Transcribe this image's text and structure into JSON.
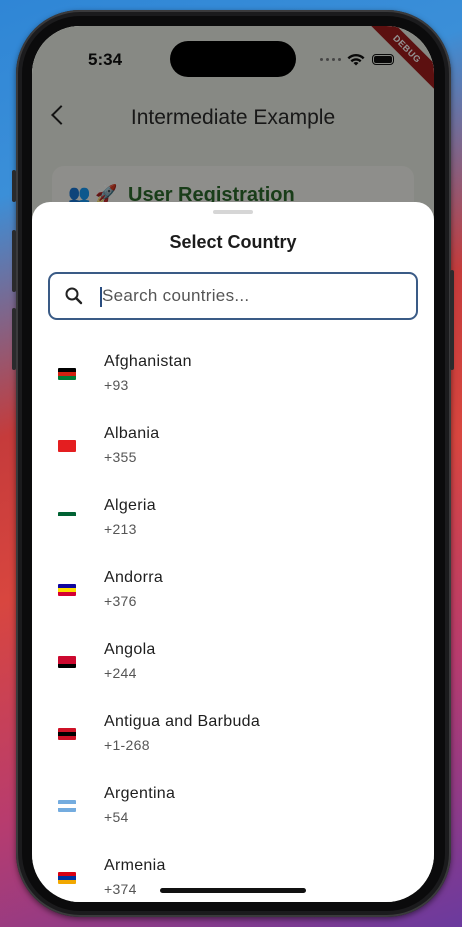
{
  "status_bar": {
    "time": "5:34",
    "debug_label": "DEBUG"
  },
  "app_bar": {
    "title": "Intermediate Example"
  },
  "background_card": {
    "title": "User Registration",
    "icons": "👥 🚀"
  },
  "sheet": {
    "title": "Select Country",
    "search": {
      "placeholder": "Search countries...",
      "value": ""
    },
    "countries": [
      {
        "name": "Afghanistan",
        "code": "+93",
        "flag_colors": [
          "#000000",
          "#d32011",
          "#007a36"
        ]
      },
      {
        "name": "Albania",
        "code": "+355",
        "flag_colors": [
          "#e41e20",
          "#e41e20",
          "#e41e20"
        ]
      },
      {
        "name": "Algeria",
        "code": "+213",
        "flag_colors": [
          "#006233",
          "#ffffff",
          "#ffffff"
        ]
      },
      {
        "name": "Andorra",
        "code": "+376",
        "flag_colors": [
          "#10069f",
          "#fedd00",
          "#d50032"
        ]
      },
      {
        "name": "Angola",
        "code": "+244",
        "flag_colors": [
          "#cc092f",
          "#cc092f",
          "#000000"
        ]
      },
      {
        "name": "Antigua and Barbuda",
        "code": "+1-268",
        "flag_colors": [
          "#ce1126",
          "#000000",
          "#ce1126"
        ]
      },
      {
        "name": "Argentina",
        "code": "+54",
        "flag_colors": [
          "#74acdf",
          "#ffffff",
          "#74acdf"
        ]
      },
      {
        "name": "Armenia",
        "code": "+374",
        "flag_colors": [
          "#d90012",
          "#0033a0",
          "#f2a800"
        ]
      }
    ]
  },
  "colors": {
    "accent": "#3a5b86",
    "app_green": "#2c6a2c",
    "scrim": "rgba(0,0,0,0.42)"
  }
}
